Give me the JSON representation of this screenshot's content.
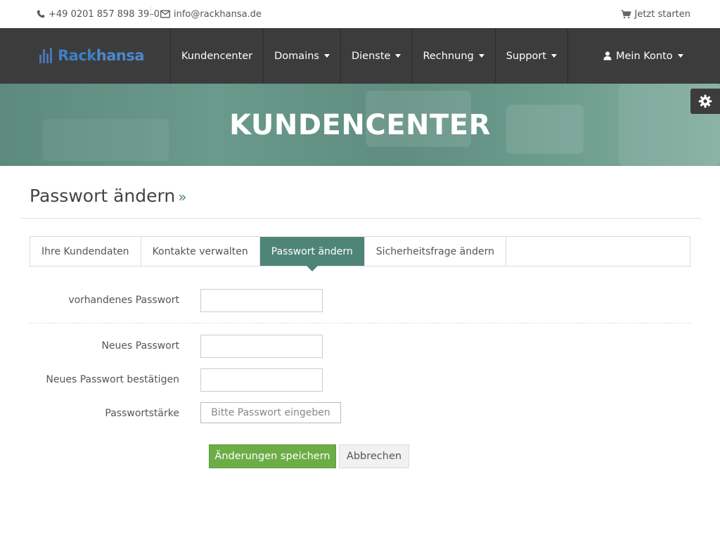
{
  "topbar": {
    "phone": "+49 0201 857 898 39–0",
    "email": "info@rackhansa.de",
    "cart_label": "Jetzt starten"
  },
  "brand": {
    "logo_part1": "Rack",
    "logo_part2": "hansa"
  },
  "nav": {
    "items": [
      {
        "label": "Kundencenter",
        "has_dropdown": false
      },
      {
        "label": "Domains",
        "has_dropdown": true
      },
      {
        "label": "Dienste",
        "has_dropdown": true
      },
      {
        "label": "Rechnung",
        "has_dropdown": true
      },
      {
        "label": "Support",
        "has_dropdown": true
      }
    ],
    "account_label": "Mein Konto"
  },
  "banner": {
    "title": "KUNDENCENTER"
  },
  "page": {
    "title": "Passwort ändern",
    "title_suffix": "»"
  },
  "tabs": [
    {
      "label": "Ihre Kundendaten",
      "active": false
    },
    {
      "label": "Kontakte verwalten",
      "active": false
    },
    {
      "label": "Passwort ändern",
      "active": true
    },
    {
      "label": "Sicherheitsfrage ändern",
      "active": false
    }
  ],
  "form": {
    "current_password_label": "vorhandenes Passwort",
    "current_password_value": "",
    "new_password_label": "Neues Passwort",
    "new_password_value": "",
    "confirm_password_label": "Neues Passwort bestätigen",
    "confirm_password_value": "",
    "strength_label": "Passwortstärke",
    "strength_text": "Bitte Passwort eingeben"
  },
  "buttons": {
    "save": "Änderungen speichern",
    "cancel": "Abbrechen"
  },
  "colors": {
    "accent": "#4f8577",
    "nav_bg": "#3c3c3c",
    "save_button": "#6cad45"
  }
}
